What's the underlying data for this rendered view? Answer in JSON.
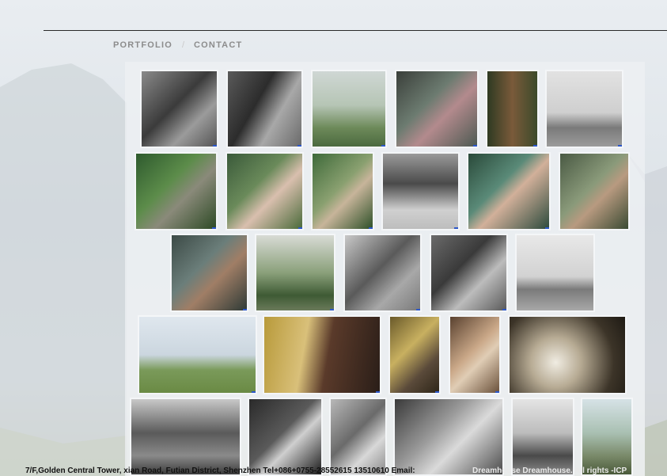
{
  "nav": {
    "items": [
      {
        "label": "PORTFOLIO"
      },
      {
        "label": "CONTACT"
      }
    ],
    "separator": "/"
  },
  "footer": {
    "address": "7/F,Golden Central Tower, xian Road, Futian District, Shenzhen Tel+086+0755-28552615 13510610 Email:",
    "brand": "Dreamhouse Dreamhouse. All rights -ICP"
  },
  "colors": {
    "nav_text": "#8c8c8c",
    "rule": "#2a2a2a",
    "thumb_marker": "#2c57c9"
  }
}
